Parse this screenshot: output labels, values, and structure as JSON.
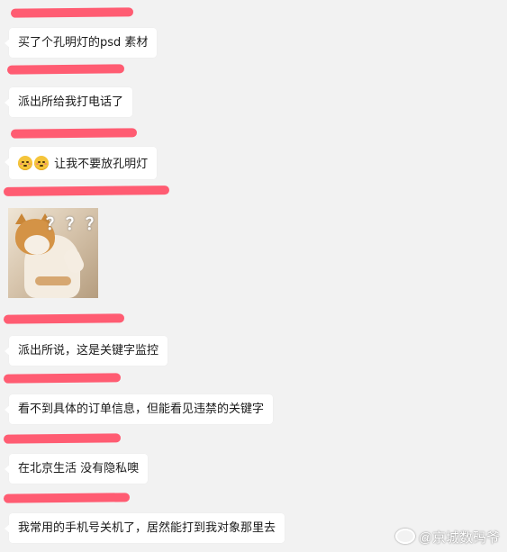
{
  "messages": [
    {
      "text": "买了个孔明灯的psd 素材"
    },
    {
      "text": "派出所给我打电话了"
    },
    {
      "text": "让我不要放孔明灯"
    },
    {
      "text": "派出所说，这是关键字监控"
    },
    {
      "text": "看不到具体的订单信息，但能看见违禁的关键字"
    },
    {
      "text": "在北京生活  没有隐私噢"
    },
    {
      "text": "我常用的手机号关机了，居然能打到我对象那里去"
    }
  ],
  "meme": {
    "caption": "？？？"
  },
  "watermark": {
    "text": "@京城数码爷"
  },
  "colors": {
    "redaction": "#ff5c72",
    "bubble": "#ffffff",
    "background": "#f2f2f2"
  }
}
